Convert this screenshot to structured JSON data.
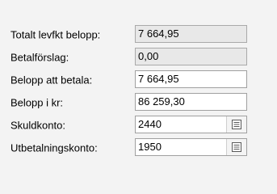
{
  "fields": [
    {
      "id": "totalt",
      "label": "Totalt levfkt belopp:",
      "value": "7 664,95",
      "readonly": true,
      "lookup": false
    },
    {
      "id": "betalforslag",
      "label": "Betalförslag:",
      "value": "0,00",
      "readonly": true,
      "lookup": false
    },
    {
      "id": "belopp-att-betala",
      "label": "Belopp att betala:",
      "value": "7 664,95",
      "readonly": false,
      "lookup": false
    },
    {
      "id": "belopp-i-kr",
      "label": "Belopp i kr:",
      "value": "86 259,30",
      "readonly": false,
      "lookup": false
    },
    {
      "id": "skuldkonto",
      "label": "Skuldkonto:",
      "value": "2440",
      "readonly": false,
      "lookup": true,
      "lookup_icon": "list-icon"
    },
    {
      "id": "utbetalningskonto",
      "label": "Utbetalningskonto:",
      "value": "1950",
      "readonly": false,
      "lookup": true,
      "lookup_icon": "list-icon"
    }
  ],
  "colors": {
    "background": "#f3f3f3",
    "readonly_field": "#e8e8e8",
    "editable_field": "#ffffff",
    "border": "#a0a0a0"
  }
}
